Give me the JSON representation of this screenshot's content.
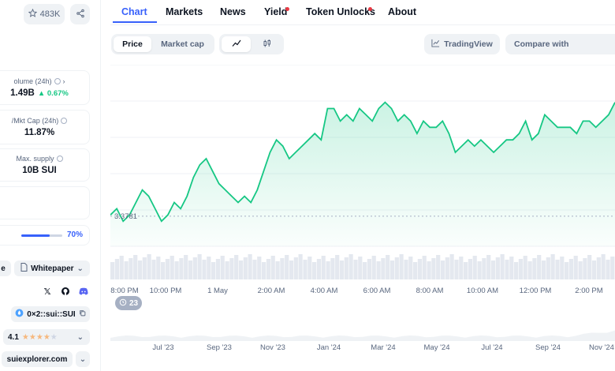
{
  "header": {
    "watchlist_count": "483K"
  },
  "tabs": [
    {
      "label": "Chart",
      "active": true,
      "dot": false
    },
    {
      "label": "Markets",
      "active": false,
      "dot": false
    },
    {
      "label": "News",
      "active": false,
      "dot": false
    },
    {
      "label": "Yield",
      "active": false,
      "dot": true
    },
    {
      "label": "Token Unlocks",
      "active": false,
      "dot": true
    },
    {
      "label": "About",
      "active": false,
      "dot": false
    }
  ],
  "stats": {
    "volume": {
      "label": "olume (24h)",
      "value": "1.49B",
      "change": "0.67%"
    },
    "vol_mkt": {
      "label": "/Mkt Cap (24h)",
      "value": "11.87%"
    },
    "max_supply": {
      "label": "Max. supply",
      "value": "10B SUI"
    },
    "progress": {
      "value": 0.7,
      "label": "70%"
    }
  },
  "links": {
    "first_btn": "e",
    "whitepaper": "Whitepaper",
    "contract": "0×2::sui::SUI",
    "rating": "4.1",
    "rating_stars": 4,
    "explorer": "suiexplorer.com"
  },
  "toolbar": {
    "price_label": "Price",
    "marketcap_label": "Market cap",
    "tradingview_label": "TradingView",
    "compare_label": "Compare with"
  },
  "chart_data": {
    "type": "line",
    "title": "",
    "xlabel": "",
    "ylabel": "",
    "reference_line": {
      "label": "3.3781",
      "value": 3.3781
    },
    "x_ticks": [
      "8:00 PM",
      "10:00 PM",
      "1 May",
      "2:00 AM",
      "4:00 AM",
      "6:00 AM",
      "8:00 AM",
      "10:00 AM",
      "12:00 PM",
      "2:00 PM"
    ],
    "series": [
      {
        "values": [
          3.38,
          3.39,
          3.37,
          3.38,
          3.4,
          3.42,
          3.41,
          3.39,
          3.37,
          3.38,
          3.4,
          3.39,
          3.41,
          3.44,
          3.46,
          3.47,
          3.45,
          3.43,
          3.42,
          3.41,
          3.4,
          3.41,
          3.4,
          3.42,
          3.45,
          3.48,
          3.5,
          3.49,
          3.47,
          3.48,
          3.49,
          3.5,
          3.51,
          3.5,
          3.55,
          3.55,
          3.53,
          3.54,
          3.53,
          3.55,
          3.54,
          3.53,
          3.55,
          3.56,
          3.55,
          3.53,
          3.54,
          3.53,
          3.51,
          3.53,
          3.52,
          3.52,
          3.53,
          3.51,
          3.48,
          3.49,
          3.5,
          3.49,
          3.5,
          3.49,
          3.48,
          3.49,
          3.5,
          3.5,
          3.51,
          3.53,
          3.5,
          3.51,
          3.54,
          3.53,
          3.52,
          3.52,
          3.52,
          3.51,
          3.53,
          3.53,
          3.52,
          3.53,
          3.54,
          3.56
        ]
      }
    ],
    "ylim": [
      3.33,
      3.62
    ]
  },
  "timeline": {
    "labels": [
      "Jul '23",
      "Sep '23",
      "Nov '23",
      "Jan '24",
      "Mar '24",
      "May '24",
      "Jul '24",
      "Sep '24",
      "Nov '24"
    ],
    "badge": "23"
  }
}
